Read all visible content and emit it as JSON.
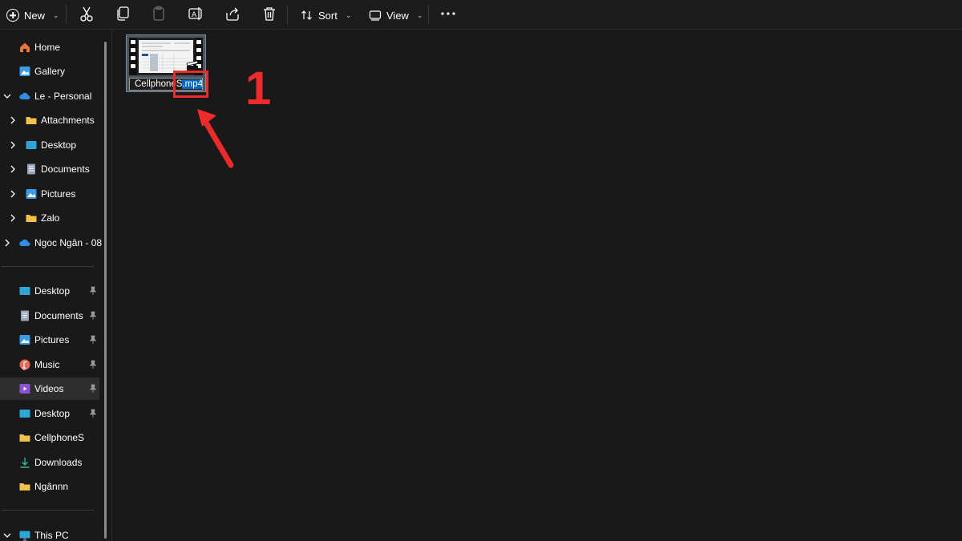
{
  "toolbar": {
    "new_label": "New",
    "sort_label": "Sort",
    "view_label": "View",
    "icons": [
      "cut-icon",
      "copy-icon",
      "paste-icon",
      "rename-icon",
      "share-icon",
      "delete-icon",
      "more-icon"
    ]
  },
  "sidebar": {
    "quick": [
      {
        "label": "Home",
        "icon": "home-icon"
      },
      {
        "label": "Gallery",
        "icon": "gallery-icon"
      }
    ],
    "onedrive": {
      "label": "Le - Personal",
      "expanded": true,
      "children": [
        {
          "label": "Attachments",
          "icon": "folder-icon"
        },
        {
          "label": "Desktop",
          "icon": "desktop-icon"
        },
        {
          "label": "Documents",
          "icon": "documents-icon"
        },
        {
          "label": "Pictures",
          "icon": "pictures-icon"
        },
        {
          "label": "Zalo",
          "icon": "folder-icon"
        }
      ]
    },
    "onedrive2": {
      "label": "Ngoc Ngân - 08"
    },
    "pinned": [
      {
        "label": "Desktop",
        "icon": "desktop-icon",
        "pinned": true
      },
      {
        "label": "Documents",
        "icon": "documents-icon",
        "pinned": true
      },
      {
        "label": "Pictures",
        "icon": "pictures-icon",
        "pinned": true
      },
      {
        "label": "Music",
        "icon": "music-icon",
        "pinned": true
      },
      {
        "label": "Videos",
        "icon": "videos-icon",
        "pinned": true,
        "selected": true
      },
      {
        "label": "Desktop",
        "icon": "desktop-icon",
        "pinned": true
      },
      {
        "label": "CellphoneS",
        "icon": "folder-icon",
        "pinned": false
      },
      {
        "label": "Downloads",
        "icon": "downloads-icon",
        "pinned": false
      },
      {
        "label": "Ngânnn",
        "icon": "folder-icon",
        "pinned": false
      }
    ],
    "this_pc": {
      "label": "This PC"
    }
  },
  "file": {
    "name_unselected": "CellphoneS",
    "name_selected": ".mp4"
  },
  "annotation": {
    "number": "1",
    "color": "#ee2a2a"
  },
  "colors": {
    "background": "#191919",
    "selection": "#0067c0",
    "folder": "#f2c04c"
  }
}
